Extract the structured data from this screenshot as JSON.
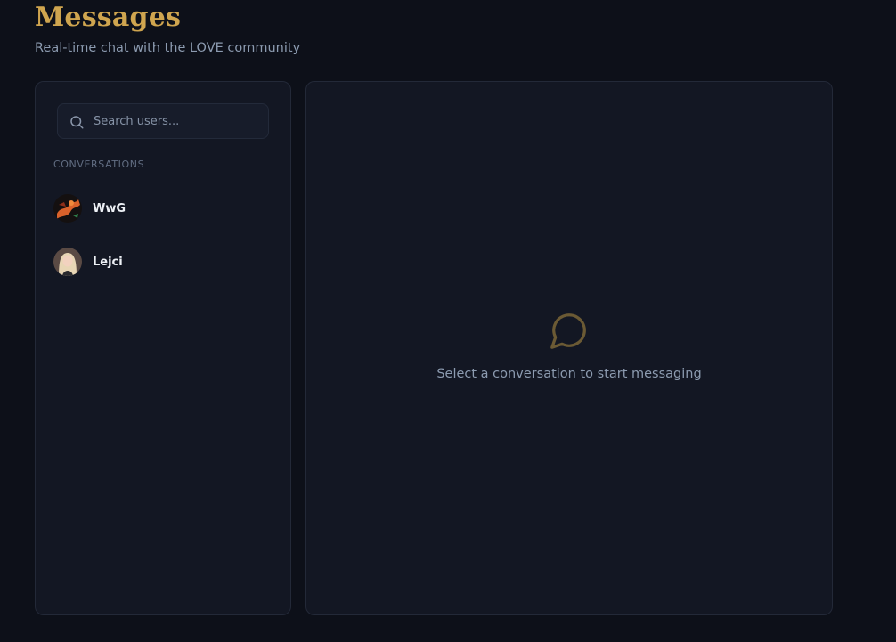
{
  "page": {
    "title": "Messages",
    "subtitle": "Real-time chat with the LOVE community"
  },
  "sidebar": {
    "search": {
      "placeholder": "Search users...",
      "value": "",
      "icon": "search-icon"
    },
    "section_label": "CONVERSATIONS",
    "conversations": [
      {
        "name": "WwG",
        "avatar": "dark-orange-avatar"
      },
      {
        "name": "Lejci",
        "avatar": "blonde-portrait-avatar"
      }
    ]
  },
  "chat": {
    "empty_icon": "chat-bubble-icon",
    "empty_message": "Select a conversation to start messaging"
  },
  "colors": {
    "accent": "#cfa54f",
    "background": "#0d1019",
    "panel": "#131723",
    "muted_text": "#8c9bb0"
  }
}
